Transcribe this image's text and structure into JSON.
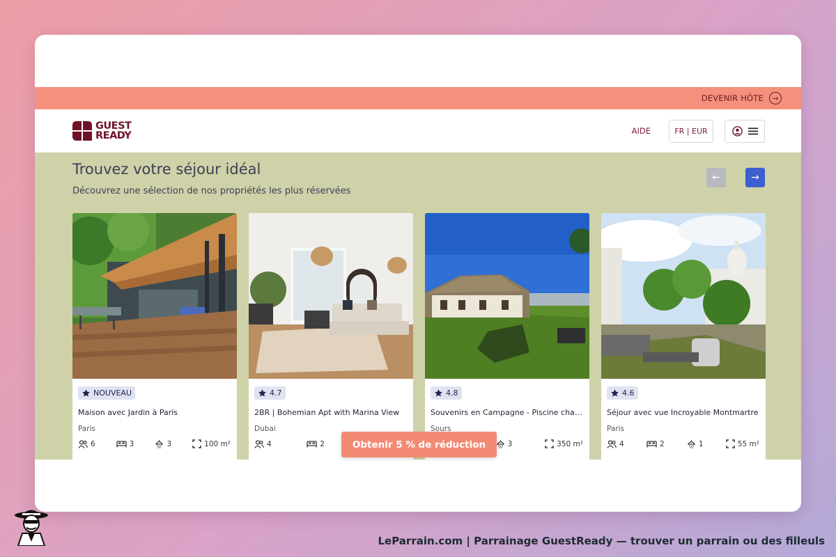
{
  "topbar": {
    "host_link": "DEVENIR HÔTE"
  },
  "navbar": {
    "logo_line1": "GUEST",
    "logo_line2": "READY",
    "help": "AIDE",
    "lang_currency": "FR | EUR"
  },
  "section": {
    "title": "Trouvez votre séjour idéal",
    "subtitle": "Découvrez une sélection de nos propriétés les plus réservées"
  },
  "cards": [
    {
      "badge": "NOUVEAU",
      "title": "Maison avec Jardin à Paris",
      "city": "Paris",
      "guests": "6",
      "beds": "3",
      "baths": "3",
      "area": "100 m²"
    },
    {
      "badge": "4.7",
      "title": "2BR | Bohemian Apt with Marina View",
      "city": "Dubai",
      "guests": "4",
      "beds": "2",
      "baths": "",
      "area": ""
    },
    {
      "badge": "4.8",
      "title": "Souvenirs en Campagne - Piscine chauffée",
      "city": "Sours",
      "guests": "",
      "beds": "",
      "baths": "3",
      "area": "350 m²"
    },
    {
      "badge": "4.6",
      "title": "Séjour avec vue Incroyable Montmartre",
      "city": "Paris",
      "guests": "4",
      "beds": "2",
      "baths": "1",
      "area": "55 m²"
    }
  ],
  "cta": {
    "label": "Obtenir 5 % de réduction"
  },
  "footer": {
    "caption": "LeParrain.com | Parrainage GuestReady — trouver un parrain ou des filleuls"
  },
  "colors": {
    "accent": "#f38b74",
    "brand": "#6f1228",
    "section_bg": "#cfd1a9",
    "nav_active": "#3d5fcf"
  }
}
